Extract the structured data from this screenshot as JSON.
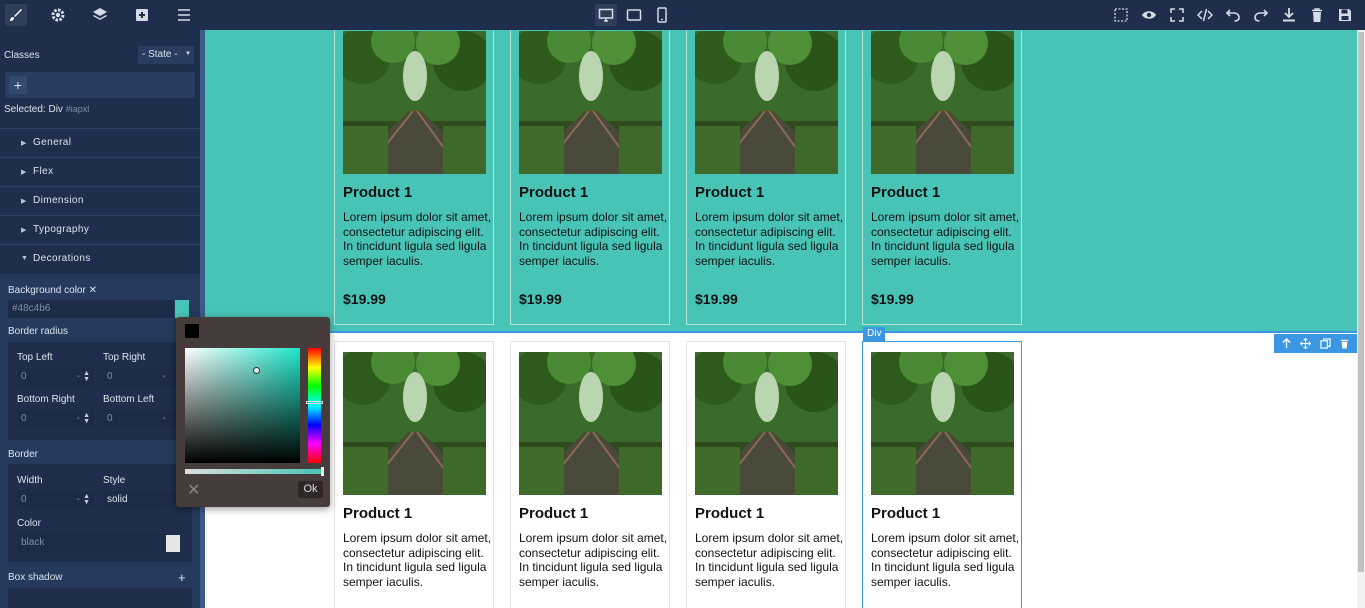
{
  "topbar": {
    "left_icons": [
      "brush-icon",
      "gear-icon",
      "layers-icon",
      "plus-square-icon",
      "menu-icon"
    ],
    "device_icons": [
      "desktop-icon",
      "tablet-icon",
      "mobile-icon"
    ],
    "right_icons": [
      "select-outline-icon",
      "eye-icon",
      "fullscreen-icon",
      "code-icon",
      "undo-icon",
      "redo-icon",
      "download-icon",
      "trash-icon",
      "save-icon"
    ]
  },
  "sidebar": {
    "classes_label": "Classes",
    "state_label": "- State -",
    "add_class": "+",
    "selected_label": "Selected:",
    "selected_name": "Div",
    "selected_id": "#iapxl",
    "sections": [
      {
        "label": "General"
      },
      {
        "label": "Flex"
      },
      {
        "label": "Dimension"
      },
      {
        "label": "Typography"
      },
      {
        "label": "Decorations"
      }
    ],
    "decorations": {
      "bg_color_label": "Background color",
      "bg_color_clear": "✕",
      "bg_color_value": "#48c4b6",
      "border_radius_label": "Border radius",
      "top_left_label": "Top Left",
      "top_right_label": "Top Right",
      "bottom_right_label": "Bottom Right",
      "bottom_left_label": "Bottom Left",
      "radius_placeholder": "0",
      "unit_dash": "-",
      "border_label": "Border",
      "width_label": "Width",
      "style_label": "Style",
      "width_placeholder": "0",
      "style_value": "solid",
      "color_label": "Color",
      "color_value": "black",
      "box_shadow_label": "Box shadow",
      "box_shadow_add": "+"
    }
  },
  "picker": {
    "ok_label": "Ok",
    "close": "✕",
    "color": "#48c4b6"
  },
  "canvas": {
    "badge": "Div",
    "row_color": "#48c4b6",
    "cards": [
      {
        "title": "Product 1",
        "desc": "Lorem ipsum dolor sit amet, consectetur adipiscing elit. In tincidunt ligula sed ligula semper iaculis.",
        "price": "$19.99"
      },
      {
        "title": "Product 1",
        "desc": "Lorem ipsum dolor sit amet, consectetur adipiscing elit. In tincidunt ligula sed ligula semper iaculis.",
        "price": "$19.99"
      },
      {
        "title": "Product 1",
        "desc": "Lorem ipsum dolor sit amet, consectetur adipiscing elit. In tincidunt ligula sed ligula semper iaculis.",
        "price": "$19.99"
      },
      {
        "title": "Product 1",
        "desc": "Lorem ipsum dolor sit amet, consectetur adipiscing elit. In tincidunt ligula sed ligula semper iaculis.",
        "price": "$19.99"
      },
      {
        "title": "Product 1",
        "desc": "Lorem ipsum dolor sit amet, consectetur adipiscing elit. In tincidunt ligula sed ligula semper iaculis."
      },
      {
        "title": "Product 1",
        "desc": "Lorem ipsum dolor sit amet, consectetur adipiscing elit. In tincidunt ligula sed ligula semper iaculis."
      },
      {
        "title": "Product 1",
        "desc": "Lorem ipsum dolor sit amet, consectetur adipiscing elit. In tincidunt ligula sed ligula semper iaculis."
      },
      {
        "title": "Product 1",
        "desc": "Lorem ipsum dolor sit amet, consectetur adipiscing elit. In tincidunt ligula sed ligula semper iaculis."
      }
    ],
    "toolbar_icons": [
      "arrow-up-icon",
      "move-icon",
      "clone-icon",
      "delete-icon"
    ]
  }
}
